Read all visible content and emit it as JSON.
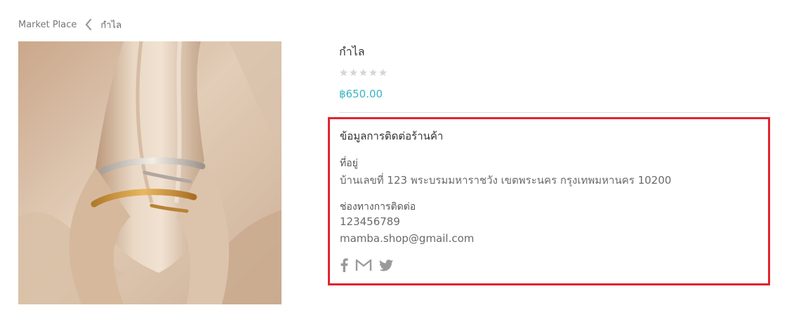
{
  "breadcrumb": {
    "root": "Market Place",
    "current": "กำไล"
  },
  "product": {
    "title": "กำไล",
    "rating": 0,
    "max_rating": 5,
    "price": "฿650.00",
    "image_alt": "gold and silver script rings on beige satin"
  },
  "contact": {
    "title": "ข้อมูลการติดต่อร้านค้า",
    "address_label": "ที่อยู่",
    "address": "บ้านเลขที่ 123 พระบรมมหาราชวัง เขตพระนคร กรุงเทพมหานคร 10200",
    "channels_label": "ช่องทางการติดต่อ",
    "phone": "123456789",
    "email": "mamba.shop@gmail.com",
    "social": [
      "facebook-icon",
      "gmail-icon",
      "twitter-icon"
    ]
  },
  "colors": {
    "price": "#3bb3c3",
    "highlight_border": "#e2232e",
    "star_empty": "#d6d6d6",
    "icon": "#9a9a9a"
  }
}
